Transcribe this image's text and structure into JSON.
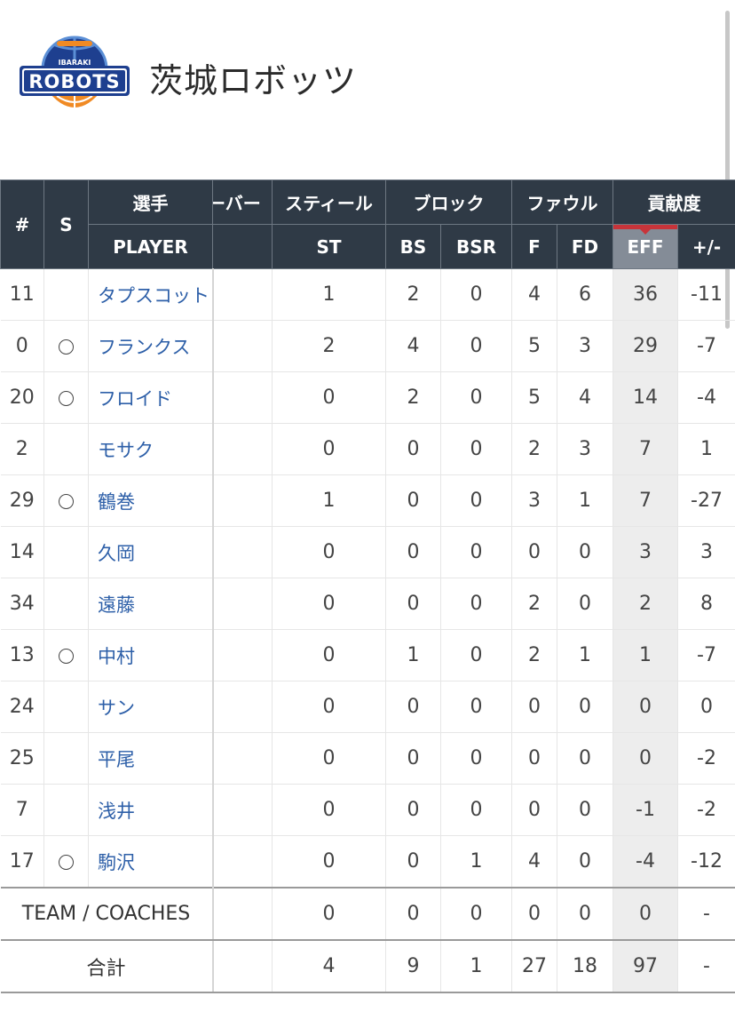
{
  "team": {
    "name": "茨城ロボッツ",
    "logo": {
      "top_text": "IBARAKI",
      "main_text": "ROBOTS",
      "icon": "basketball-robot-logo",
      "colors": {
        "navy": "#1e3f8f",
        "orange": "#f08a24",
        "light_blue": "#5b8fd6"
      }
    }
  },
  "table": {
    "header_top": {
      "no": "#",
      "starter": "S",
      "player": "選手",
      "turnover": "ーバー",
      "steal": "スティール",
      "block": "ブロック",
      "foul": "ファウル",
      "contribution": "貢献度"
    },
    "header_sub": {
      "player": "PLAYER",
      "st": "ST",
      "bs": "BS",
      "bsr": "BSR",
      "f": "F",
      "fd": "FD",
      "eff": "EFF",
      "pm": "+/-"
    },
    "starter_mark": "○",
    "rows": [
      {
        "no": "11",
        "starter": false,
        "name": "タプスコット",
        "st": "1",
        "bs": "2",
        "bsr": "0",
        "f": "4",
        "fd": "6",
        "eff": "36",
        "pm": "-11"
      },
      {
        "no": "0",
        "starter": true,
        "name": "フランクス",
        "st": "2",
        "bs": "4",
        "bsr": "0",
        "f": "5",
        "fd": "3",
        "eff": "29",
        "pm": "-7"
      },
      {
        "no": "20",
        "starter": true,
        "name": "フロイド",
        "st": "0",
        "bs": "2",
        "bsr": "0",
        "f": "5",
        "fd": "4",
        "eff": "14",
        "pm": "-4"
      },
      {
        "no": "2",
        "starter": false,
        "name": "モサク",
        "st": "0",
        "bs": "0",
        "bsr": "0",
        "f": "2",
        "fd": "3",
        "eff": "7",
        "pm": "1"
      },
      {
        "no": "29",
        "starter": true,
        "name": "鶴巻",
        "st": "1",
        "bs": "0",
        "bsr": "0",
        "f": "3",
        "fd": "1",
        "eff": "7",
        "pm": "-27"
      },
      {
        "no": "14",
        "starter": false,
        "name": "久岡",
        "st": "0",
        "bs": "0",
        "bsr": "0",
        "f": "0",
        "fd": "0",
        "eff": "3",
        "pm": "3"
      },
      {
        "no": "34",
        "starter": false,
        "name": "遠藤",
        "st": "0",
        "bs": "0",
        "bsr": "0",
        "f": "2",
        "fd": "0",
        "eff": "2",
        "pm": "8"
      },
      {
        "no": "13",
        "starter": true,
        "name": "中村",
        "st": "0",
        "bs": "1",
        "bsr": "0",
        "f": "2",
        "fd": "1",
        "eff": "1",
        "pm": "-7"
      },
      {
        "no": "24",
        "starter": false,
        "name": "サン",
        "st": "0",
        "bs": "0",
        "bsr": "0",
        "f": "0",
        "fd": "0",
        "eff": "0",
        "pm": "0"
      },
      {
        "no": "25",
        "starter": false,
        "name": "平尾",
        "st": "0",
        "bs": "0",
        "bsr": "0",
        "f": "0",
        "fd": "0",
        "eff": "0",
        "pm": "-2"
      },
      {
        "no": "7",
        "starter": false,
        "name": "浅井",
        "st": "0",
        "bs": "0",
        "bsr": "0",
        "f": "0",
        "fd": "0",
        "eff": "-1",
        "pm": "-2"
      },
      {
        "no": "17",
        "starter": true,
        "name": "駒沢",
        "st": "0",
        "bs": "0",
        "bsr": "1",
        "f": "4",
        "fd": "0",
        "eff": "-4",
        "pm": "-12"
      }
    ],
    "team_row": {
      "label": "TEAM / COACHES",
      "st": "0",
      "bs": "0",
      "bsr": "0",
      "f": "0",
      "fd": "0",
      "eff": "0",
      "pm": "-"
    },
    "total_row": {
      "label": "合計",
      "st": "4",
      "bs": "9",
      "bsr": "1",
      "f": "27",
      "fd": "18",
      "eff": "97",
      "pm": "-"
    }
  },
  "colors": {
    "header_bg": "#2f3a46",
    "eff_header_bg": "#848c97",
    "eff_accent": "#c8343a",
    "player_link": "#2d5fa8",
    "eff_col_bg": "#ededed"
  }
}
